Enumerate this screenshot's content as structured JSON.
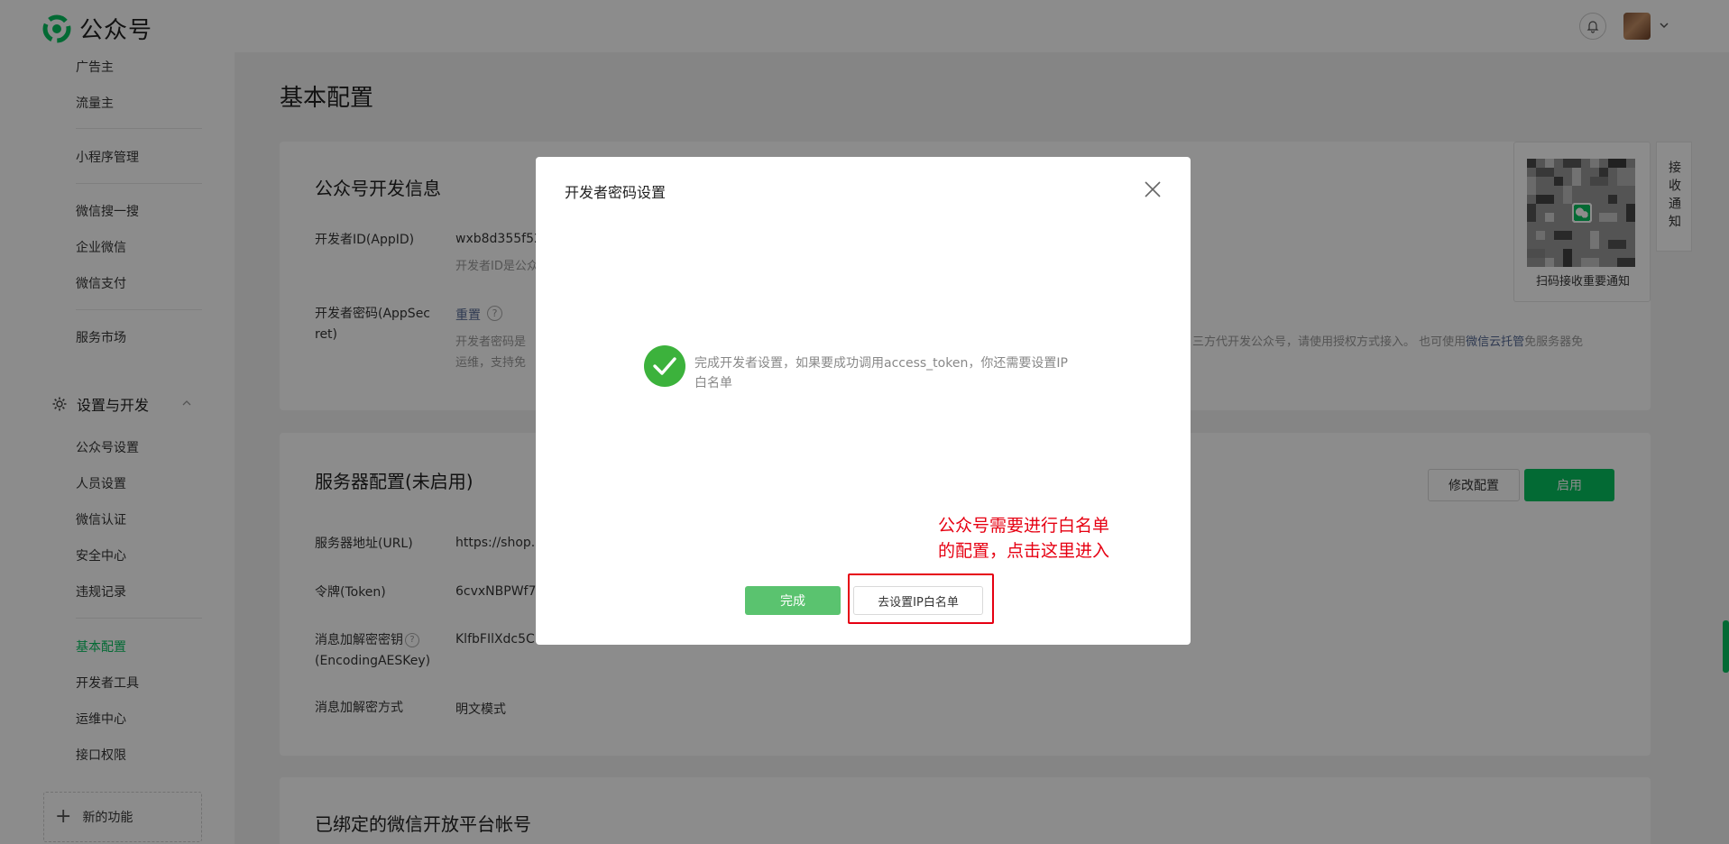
{
  "header": {
    "logo_text": "公众号",
    "notification_icon": "bell-icon",
    "avatar_icon": "avatar"
  },
  "sidebar": {
    "items_top": [
      "广告主",
      "流量主",
      "小程序管理",
      "微信搜一搜",
      "企业微信",
      "微信支付",
      "服务市场"
    ],
    "group": {
      "label": "设置与开发",
      "icon": "gear-icon",
      "expanded": true
    },
    "group_items": [
      "公众号设置",
      "人员设置",
      "微信认证",
      "安全中心",
      "违规记录",
      "基本配置",
      "开发者工具",
      "运维中心",
      "接口权限"
    ],
    "active_item": "基本配置",
    "new_feature_label": "新的功能"
  },
  "main": {
    "page_title": "基本配置",
    "dev_info": {
      "title": "公众号开发信息",
      "appid_label": "开发者ID(AppID)",
      "appid_value": "wxb8d355f52",
      "appid_hint": "开发者ID是公众",
      "secret_label_1": "开发者密码(AppSec",
      "secret_label_2": "ret)",
      "secret_reset": "重置",
      "secret_hint_1_left": "开发者密码是",
      "secret_hint_1_right_a": "三方代开发公众号，请使用授权方式接入。 也可使用",
      "secret_hint_1_link": "微信云托管",
      "secret_hint_1_right_b": "免服务器免",
      "secret_hint_2": "运维，支持免"
    },
    "server_config": {
      "title": "服务器配置(未启用)",
      "edit_button": "修改配置",
      "enable_button": "启用",
      "url_label": "服务器地址(URL)",
      "url_value": "https://shop.",
      "token_label": "令牌(Token)",
      "token_value": "6cvxNBPWf74",
      "aes_label_1": "消息加解密密钥",
      "aes_label_2": "(EncodingAESKey)",
      "aes_value": "KlfbFIlXdc5C",
      "mode_label": "消息加解密方式",
      "mode_value": "明文模式"
    },
    "bound_platform": {
      "title": "已绑定的微信开放平台帐号"
    },
    "qr": {
      "caption": "扫码接收重要通知"
    },
    "notify_tab": "接收通知"
  },
  "dialog": {
    "title": "开发者密码设置",
    "close_icon": "close-icon",
    "success_icon": "check-circle-icon",
    "message": "完成开发者设置，如果要成功调用access_token，你还需要设置IP白名单",
    "done_button": "完成",
    "ip_whitelist_button": "去设置IP白名单"
  },
  "annotation": {
    "line1": "公众号需要进行白名单",
    "line2": "的配置，点击这里进入",
    "color": "#e60012"
  },
  "colors": {
    "brand_green": "#07c160",
    "link_blue": "#576b95"
  }
}
